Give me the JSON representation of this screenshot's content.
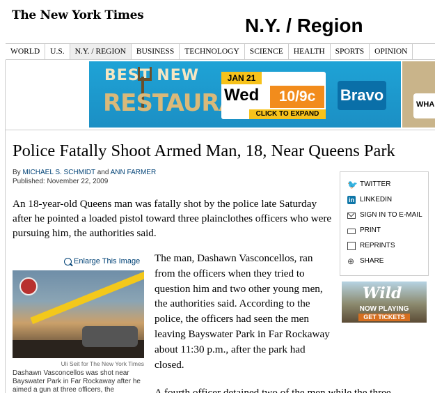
{
  "masthead": {
    "logo": "The New York Times",
    "section_title": "N.Y. / Region"
  },
  "nav": {
    "items": [
      "WORLD",
      "U.S.",
      "N.Y. / REGION",
      "BUSINESS",
      "TECHNOLOGY",
      "SCIENCE",
      "HEALTH",
      "SPORTS",
      "OPINION"
    ],
    "active": "N.Y. / REGION"
  },
  "ad_banner": {
    "best_new": "BEST NEW",
    "restaurant": "RESTAURANT",
    "date": "JAN 21",
    "day": "Wed",
    "time": "10/9c",
    "expand": "CLICK TO EXPAND",
    "network": "Bravo",
    "side_text": "WHA"
  },
  "article": {
    "headline": "Police Fatally Shoot Armed Man, 18, Near Queens Park",
    "byline_prefix": "By",
    "author1": "MICHAEL S. SCHMIDT",
    "byline_and": "and",
    "author2": "ANN FARMER",
    "published": "Published: November 22, 2009",
    "lead": "An 18-year-old Queens man was fatally shot by the police late Saturday after he pointed a loaded pistol toward three plainclothes officers who were pursuing him, the authorities said.",
    "enlarge": "Enlarge This Image",
    "photo_credit": "Uli Seit for The New York Times",
    "caption": "Dashawn Vasconcellos was shot near Bayswater Park in Far Rockaway after he aimed a gun at three officers, the",
    "body1": "The man, Dashawn Vasconcellos, ran from the officers when they tried to question him and two other young men, the authorities said. According to the police, the officers had seen the men leaving Bayswater Park in Far Rockaway about 11:30 p.m., after the park had closed.",
    "body2": "A fourth officer detained two of the men while the three"
  },
  "tools": {
    "twitter": "TWITTER",
    "linkedin": "LINKEDIN",
    "sign_in": "SIGN IN TO E-MAIL",
    "print": "PRINT",
    "reprints": "REPRINTS",
    "share": "SHARE"
  },
  "tools_ad": {
    "title": "Wild",
    "now_playing": "NOW PLAYING",
    "get_tickets": "GET TICKETS"
  }
}
